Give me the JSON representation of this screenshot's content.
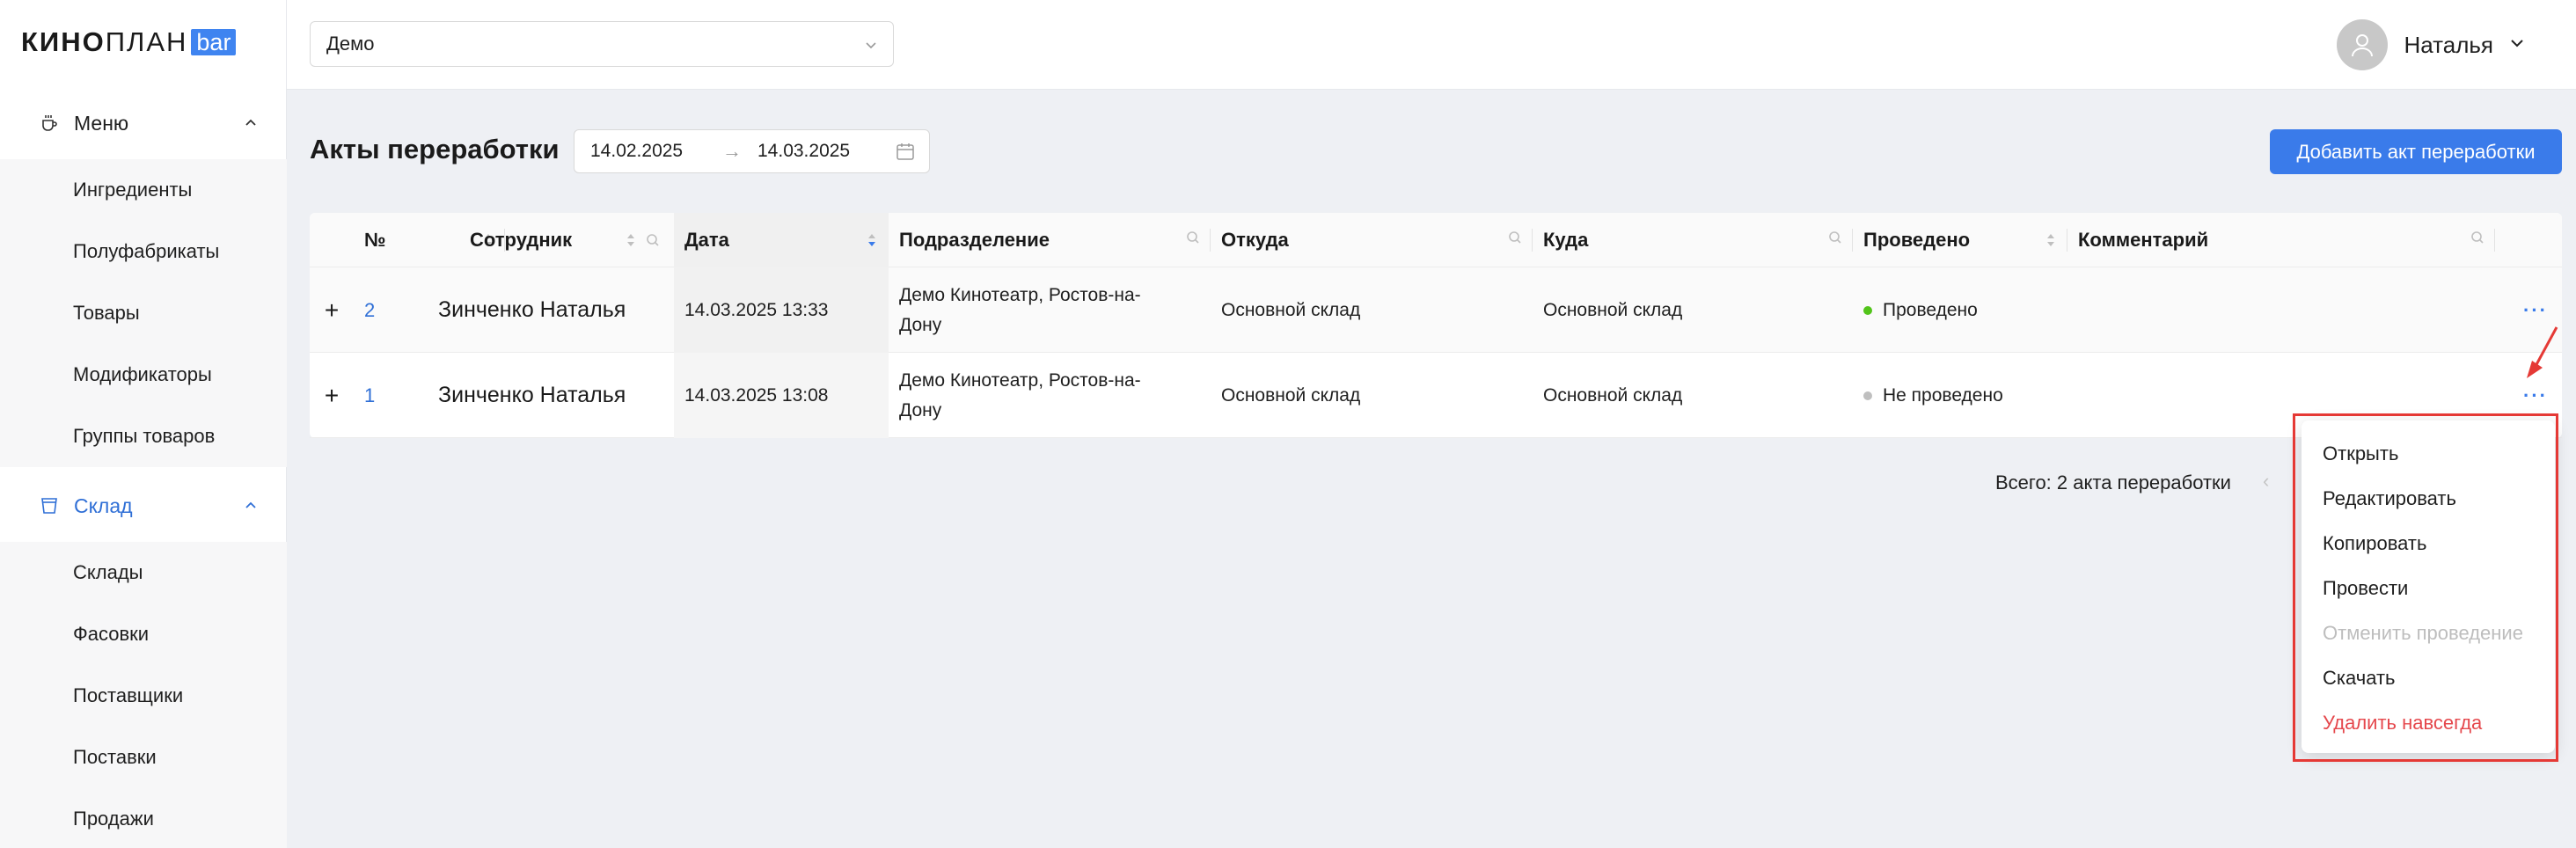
{
  "logo": {
    "main": "КИНО",
    "light": "ПЛАН",
    "badge": "bar"
  },
  "sidebar": {
    "menu_group": {
      "label": "Меню",
      "items": [
        "Ингредиенты",
        "Полуфабрикаты",
        "Товары",
        "Модификаторы",
        "Группы товаров"
      ]
    },
    "warehouse_group": {
      "label": "Склад",
      "items": [
        "Склады",
        "Фасовки",
        "Поставщики",
        "Поставки",
        "Продажи"
      ]
    }
  },
  "topbar": {
    "select_value": "Демо",
    "user_name": "Наталья"
  },
  "page": {
    "title": "Акты переработки",
    "date_from": "14.02.2025",
    "date_to": "14.03.2025",
    "arrow": "→",
    "add_button": "Добавить акт переработки"
  },
  "table": {
    "headers": {
      "num": "№",
      "employee": "Сотрудник",
      "date": "Дата",
      "department": "Подразделение",
      "from": "Откуда",
      "to": "Куда",
      "status": "Проведено",
      "comment": "Комментарий"
    },
    "rows": [
      {
        "expand": "+",
        "num": "2",
        "employee": "Зинченко Наталья",
        "date": "14.03.2025 13:33",
        "department": "Демо Кинотеатр, Ростов-на-Дону",
        "from": "Основной склад",
        "to": "Основной склад",
        "status": "Проведено",
        "comment": "",
        "more": "···"
      },
      {
        "expand": "+",
        "num": "1",
        "employee": "Зинченко Наталья",
        "date": "14.03.2025 13:08",
        "department": "Демо Кинотеатр, Ростов-на-Дону",
        "from": "Основной склад",
        "to": "Основной склад",
        "status": "Не проведено",
        "comment": "",
        "more": "···"
      }
    ]
  },
  "footer": {
    "total": "Всего: 2 акта переработки",
    "prev": "‹"
  },
  "context_menu": [
    "Открыть",
    "Редактировать",
    "Копировать",
    "Провести",
    "Отменить проведение",
    "Скачать",
    "Удалить навсегда"
  ],
  "colors": {
    "accent": "#3a7bea",
    "active_nav": "#2f6fd6",
    "status_done": "#52c41a",
    "status_not_done": "#bfbfbf",
    "danger": "#e5484d",
    "highlight": "#e53935"
  }
}
